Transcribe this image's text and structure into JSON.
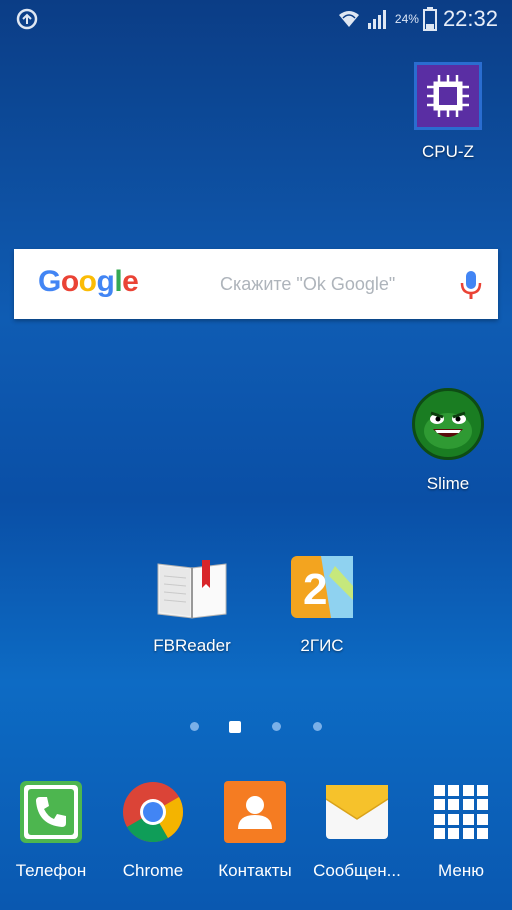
{
  "status_bar": {
    "time": "22:32",
    "battery_percent": "24%",
    "icons": [
      "sync-icon",
      "wifi-icon",
      "signal-icon",
      "battery-icon"
    ]
  },
  "home": {
    "apps": [
      {
        "label": "CPU-Z",
        "icon": "cpu-chip-icon"
      },
      {
        "label": "Slime",
        "icon": "slime-face-icon"
      },
      {
        "label": "FBReader",
        "icon": "book-icon"
      },
      {
        "label": "2ГИС",
        "icon": "map-2gis-icon"
      }
    ],
    "search": {
      "logo": "Google",
      "hint": "Скажите \"Ok Google\"",
      "mic_icon": "mic-icon"
    },
    "pages": {
      "count": 4,
      "active_index": 1
    }
  },
  "dock": {
    "items": [
      {
        "label": "Телефон",
        "icon": "phone-icon"
      },
      {
        "label": "Chrome",
        "icon": "chrome-icon"
      },
      {
        "label": "Контакты",
        "icon": "contacts-icon"
      },
      {
        "label": "Сообщен...",
        "icon": "messages-icon"
      },
      {
        "label": "Меню",
        "icon": "apps-grid-icon"
      }
    ]
  },
  "colors": {
    "google_blue": "#4285F4",
    "google_red": "#EA4335",
    "google_yellow": "#FBBC05",
    "google_green": "#34A853"
  }
}
